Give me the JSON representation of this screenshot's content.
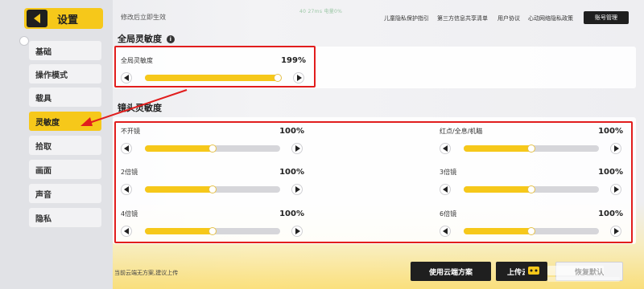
{
  "sidebar": {
    "title": "设置",
    "items": [
      {
        "label": "基础",
        "active": false
      },
      {
        "label": "操作模式",
        "active": false
      },
      {
        "label": "载具",
        "active": false
      },
      {
        "label": "灵敏度",
        "active": true
      },
      {
        "label": "拾取",
        "active": false
      },
      {
        "label": "画面",
        "active": false
      },
      {
        "label": "声音",
        "active": false
      },
      {
        "label": "隐私",
        "active": false
      }
    ]
  },
  "topbar": {
    "notice": "修改后立即生效",
    "status": "40 27ms 电量0%",
    "links": [
      "儿童隐私保护指引",
      "第三方信息共享清单",
      "用户协议",
      "心动网络隐私政策"
    ],
    "account_button": "账号管理"
  },
  "global_section": {
    "title": "全局灵敏度",
    "slider": {
      "label": "全局灵敏度",
      "value_text": "199%",
      "fill": 0.99
    }
  },
  "lens_section": {
    "title": "镜头灵敏度",
    "sliders": [
      {
        "label": "不开镜",
        "value_text": "100%",
        "fill": 0.5
      },
      {
        "label": "红点/全息/机瞄",
        "value_text": "100%",
        "fill": 0.5
      },
      {
        "label": "2倍镜",
        "value_text": "100%",
        "fill": 0.5
      },
      {
        "label": "3倍镜",
        "value_text": "100%",
        "fill": 0.5
      },
      {
        "label": "4倍镜",
        "value_text": "100%",
        "fill": 0.5
      },
      {
        "label": "6倍镜",
        "value_text": "100%",
        "fill": 0.5
      }
    ]
  },
  "footer": {
    "note": "当前云端无方案,建议上传",
    "use_cloud_button": "使用云端方案",
    "upload_button": "上传云端",
    "reset_button": "恢复默认"
  },
  "colors": {
    "accent": "#f6c81a",
    "highlight": "#e11d1d",
    "dark": "#1f1f1f"
  },
  "icons": {
    "back": "triangle-left",
    "info": "info-circle",
    "decrease": "triangle-left",
    "increase": "triangle-right"
  }
}
